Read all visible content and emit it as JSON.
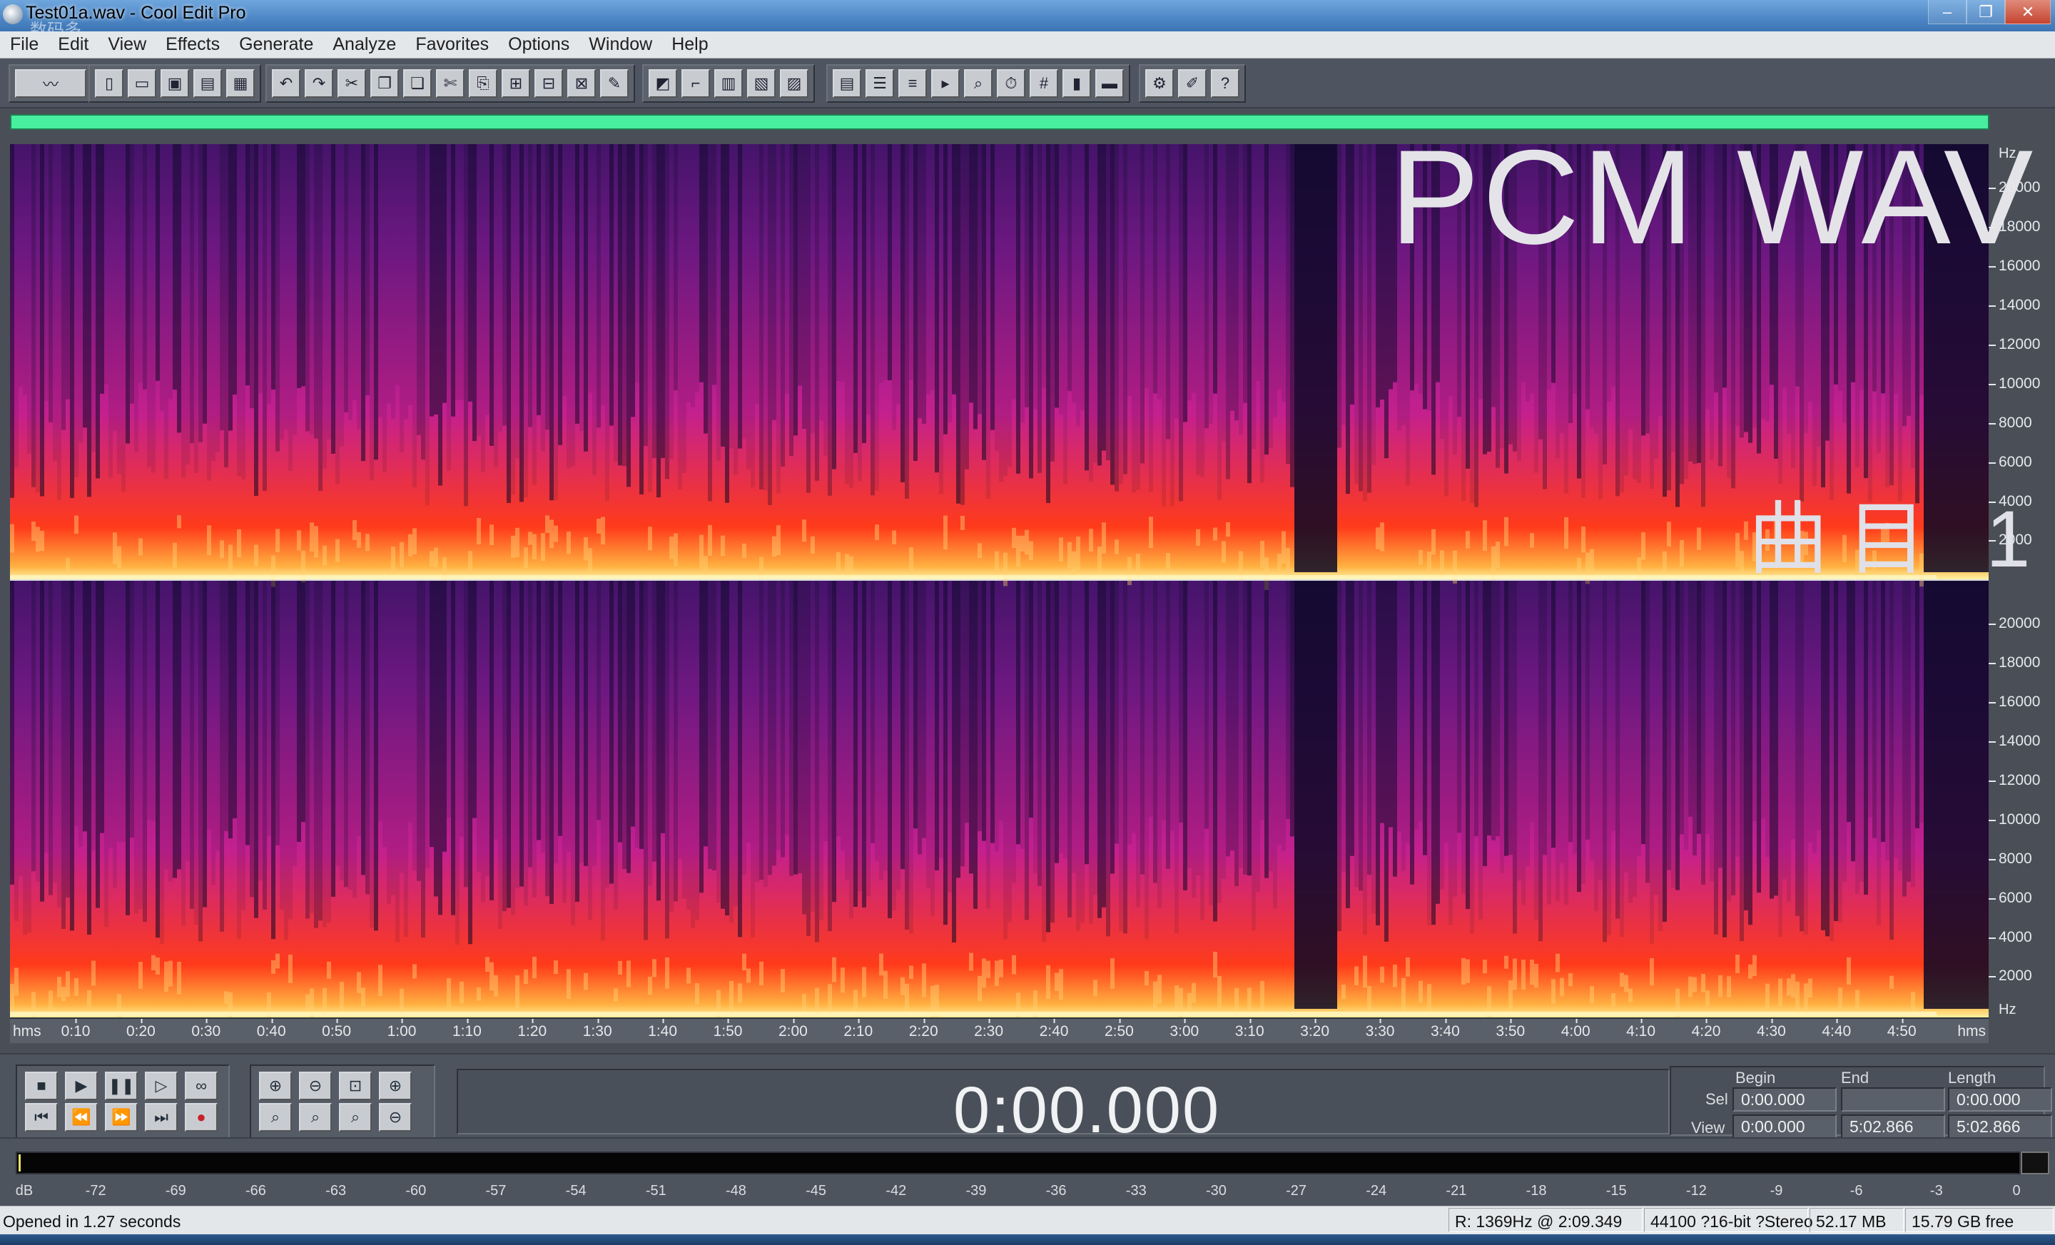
{
  "window": {
    "title": "Test01a.wav - Cool Edit Pro",
    "minimize": "–",
    "restore": "❐",
    "close": "✕",
    "watermark": "数码多"
  },
  "menu": [
    "File",
    "Edit",
    "View",
    "Effects",
    "Generate",
    "Analyze",
    "Favorites",
    "Options",
    "Window",
    "Help"
  ],
  "toolbar": {
    "group1_icon": "waveform-spectral-toggle-icon"
  },
  "overlay": {
    "title": "PCM  WAV",
    "track": "曲目 1"
  },
  "spectral_scale": {
    "unit": "Hz",
    "labels": [
      "20000",
      "18000",
      "16000",
      "14000",
      "12000",
      "10000",
      "8000",
      "6000",
      "4000",
      "2000"
    ]
  },
  "time_ruler": {
    "start": "hms",
    "end": "hms",
    "labels": [
      "0:10",
      "0:20",
      "0:30",
      "0:40",
      "0:50",
      "1:00",
      "1:10",
      "1:20",
      "1:30",
      "1:40",
      "1:50",
      "2:00",
      "2:10",
      "2:20",
      "2:30",
      "2:40",
      "2:50",
      "3:00",
      "3:10",
      "3:20",
      "3:30",
      "3:40",
      "3:50",
      "4:00",
      "4:10",
      "4:20",
      "4:30",
      "4:40",
      "4:50"
    ]
  },
  "transport": {
    "time": "0:00.000",
    "stop": "■",
    "play": "▶",
    "pause": "❚❚",
    "play_to_end": "▷",
    "loop": "∞",
    "go_start": "⏮",
    "rewind": "⏪",
    "forward": "⏩",
    "go_end": "⏭",
    "record": "●"
  },
  "selection": {
    "begin_label": "Begin",
    "end_label": "End",
    "length_label": "Length",
    "sel_label": "Sel",
    "view_label": "View",
    "sel_begin": "0:00.000",
    "sel_end": "",
    "sel_length": "0:00.000",
    "view_begin": "0:00.000",
    "view_end": "5:02.866",
    "view_length": "5:02.866"
  },
  "meter": {
    "labels": [
      "dB",
      "-72",
      "-69",
      "-66",
      "-63",
      "-60",
      "-57",
      "-54",
      "-51",
      "-48",
      "-45",
      "-42",
      "-39",
      "-36",
      "-33",
      "-30",
      "-27",
      "-24",
      "-21",
      "-18",
      "-15",
      "-12",
      "-9",
      "-6",
      "-3",
      "0"
    ]
  },
  "status": {
    "message": "Opened in 1.27 seconds",
    "cursor": "R: 1369Hz @  2:09.349",
    "format": "44100 ?16-bit ?Stereo",
    "size": "52.17 MB",
    "free": "15.79 GB free"
  },
  "colors": {
    "accent": "#47ef9f",
    "spectral_low": "#0b0826",
    "spectral_mid": "#7a1a8c",
    "spectral_high": "#ff3b1a",
    "spectral_peak": "#fff2a0"
  }
}
